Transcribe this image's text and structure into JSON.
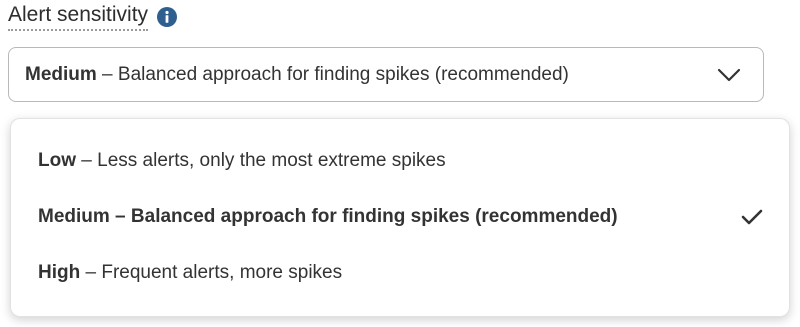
{
  "field": {
    "label": "Alert sensitivity",
    "info_icon": "info-icon"
  },
  "select": {
    "selected_strong": "Medium",
    "selected_sep": " – ",
    "selected_rest": "Balanced approach for finding spikes (recommended)",
    "chevron_icon": "chevron-down-icon"
  },
  "options": [
    {
      "strong": "Low",
      "sep": " – ",
      "rest": "Less alerts, only the most extreme spikes",
      "selected": false
    },
    {
      "strong": "Medium",
      "sep": " – ",
      "rest": "Balanced approach for finding spikes (recommended)",
      "selected": true
    },
    {
      "strong": "High",
      "sep": " – ",
      "rest": "Frequent alerts, more spikes",
      "selected": false
    }
  ],
  "colors": {
    "info_icon_bg": "#2f5f8f",
    "text": "#333333",
    "border": "#b9b9b9"
  },
  "check_icon": "check-icon"
}
